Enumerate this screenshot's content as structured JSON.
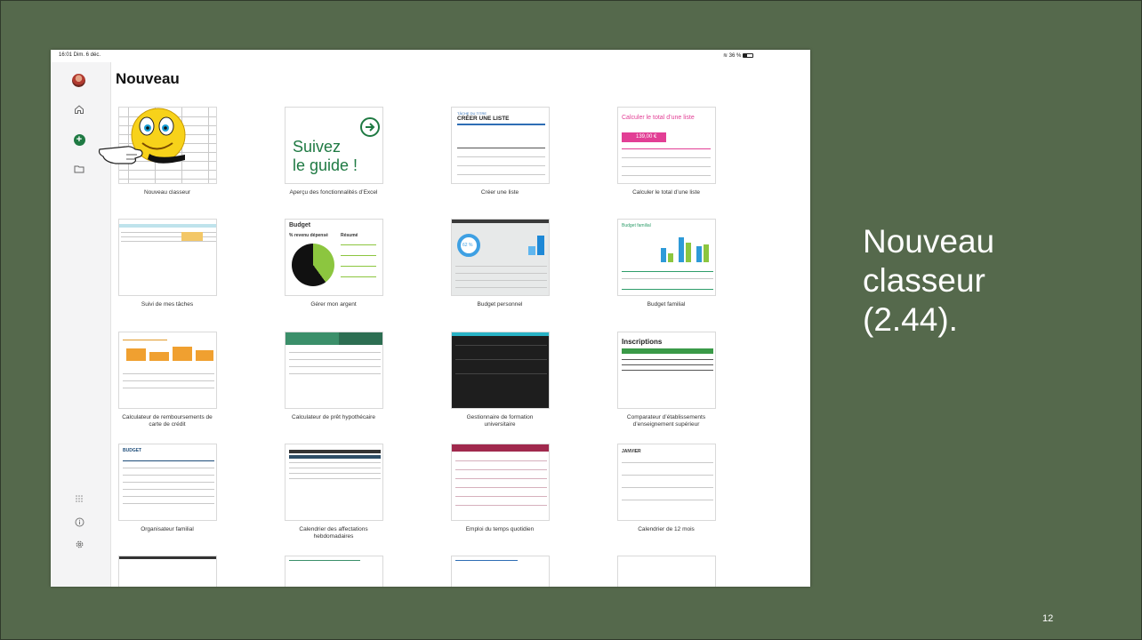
{
  "slide": {
    "caption_lines": [
      "Nouveau",
      "classeur",
      "(2.44)."
    ],
    "page_number": "12"
  },
  "status": {
    "time": "16:01  Dim. 6 déc.",
    "wifi_battery": "36 %",
    "battery_level": 0.36
  },
  "header": {
    "title": "Nouveau"
  },
  "sidebar": {
    "icons": [
      "avatar",
      "home-icon",
      "new-icon",
      "folder-icon",
      "apps-icon",
      "info-icon",
      "settings-icon"
    ]
  },
  "templates": [
    {
      "label": "Nouveau classeur"
    },
    {
      "label": "Aperçu des fonctionnalités d’Excel",
      "thumb_text": [
        "Suivez",
        "le guide !"
      ]
    },
    {
      "label": "Créer une liste",
      "thumb_small": "TÂCHE DU TITRE",
      "thumb_title": "CRÉER UNE LISTE"
    },
    {
      "label": "Calculer le total d’une liste",
      "thumb_title": "Calculer le total d’une liste",
      "thumb_value": "139,00 €"
    },
    {
      "label": "Suivi de mes tâches"
    },
    {
      "label": "Gérer mon argent",
      "thumb_title": "Budget",
      "thumb_sub1": "% revenu dépensé",
      "thumb_sub2": "Résumé"
    },
    {
      "label": "Budget personnel",
      "thumb_value": "62 %"
    },
    {
      "label": "Budget familial",
      "thumb_title": "Budget familial"
    },
    {
      "label_lines": [
        "Calculateur de remboursements de",
        "carte de crédit"
      ]
    },
    {
      "label": "Calculateur de prêt hypothécaire"
    },
    {
      "label_lines": [
        "Gestionnaire de formation",
        "universitaire"
      ]
    },
    {
      "label_lines": [
        "Comparateur d’établissements",
        "d’enseignement supérieur"
      ],
      "thumb_title": "Inscriptions"
    },
    {
      "label": "Organisateur familial",
      "thumb_title": "BUDGET"
    },
    {
      "label_lines": [
        "Calendrier des affectations",
        "hebdomadaires"
      ]
    },
    {
      "label": "Emploi du temps quotidien"
    },
    {
      "label": "Calendrier de 12 mois",
      "thumb_title": "JANVIER"
    }
  ],
  "colors": {
    "slide_bg": "#55694c",
    "excel_green": "#1f7a43",
    "accent_pink": "#e23f95"
  }
}
